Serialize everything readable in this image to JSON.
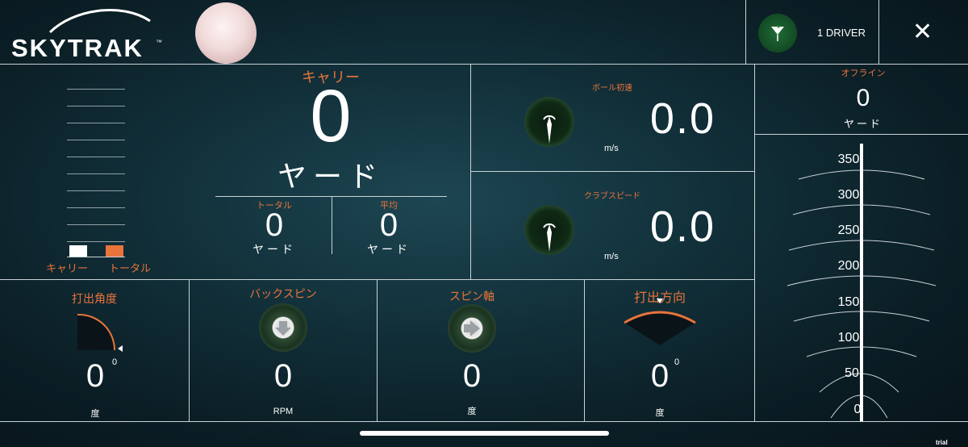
{
  "header": {
    "logo": "SKYTRAK",
    "logo_tm": "™",
    "club": "1 DRIVER",
    "close": "✕"
  },
  "carry": {
    "label": "キャリー",
    "value": "0",
    "unit": "ヤード"
  },
  "total": {
    "label": "トータル",
    "value": "0",
    "unit": "ヤード"
  },
  "average": {
    "label": "平均",
    "value": "0",
    "unit": "ヤード"
  },
  "legend": {
    "carry": "キャリー",
    "total": "トータル",
    "carry_color": "#ffffff",
    "total_color": "#e8743b"
  },
  "ball_speed": {
    "label": "ボール初速",
    "value": "0.0",
    "unit": "m/s"
  },
  "club_speed": {
    "label": "クラブスピード",
    "value": "0.0",
    "unit": "m/s"
  },
  "offline": {
    "label": "オフライン",
    "value": "0",
    "unit": "ヤード"
  },
  "launch_angle": {
    "label": "打出角度",
    "value": "0",
    "sup": "0",
    "unit": "度"
  },
  "backspin": {
    "label": "バックスピン",
    "value": "0",
    "unit": "RPM"
  },
  "spin_axis": {
    "label": "スピン軸",
    "value": "0",
    "unit": "度"
  },
  "launch_direction": {
    "label": "打出方向",
    "value": "0",
    "sup": "0",
    "unit": "度"
  },
  "scale": [
    "350",
    "300",
    "250",
    "200",
    "150",
    "100",
    "50",
    "0"
  ],
  "footer": {
    "trial": "trial version"
  },
  "colors": {
    "accent": "#e8743b",
    "line": "#c9d3d6",
    "background": "#0f2a33"
  }
}
